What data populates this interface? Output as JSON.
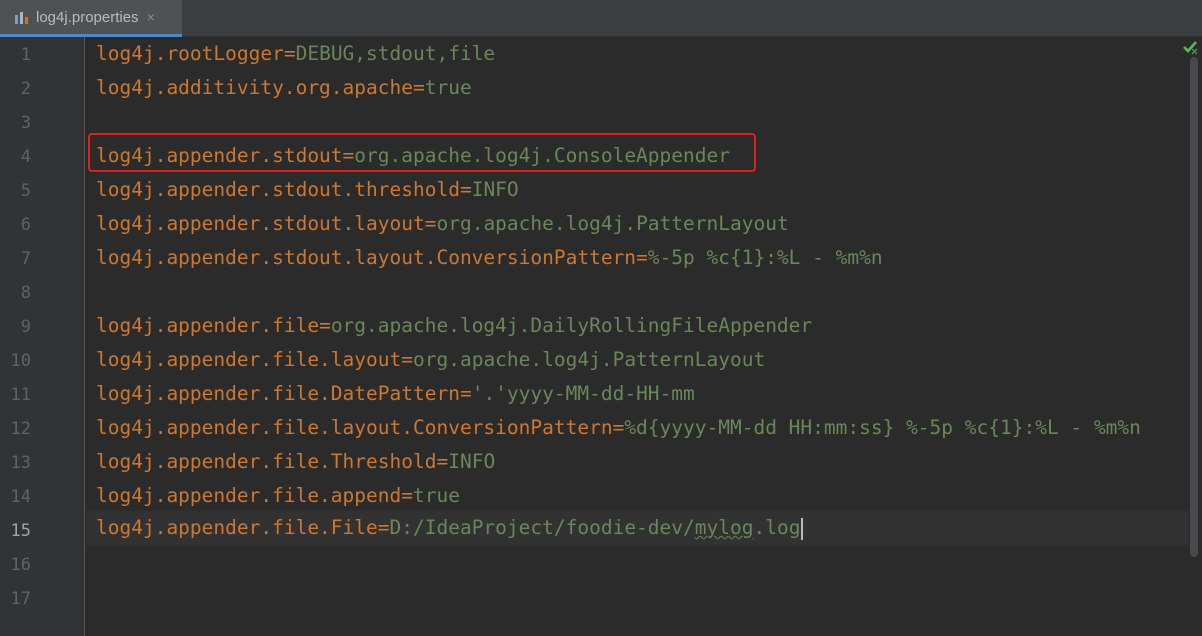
{
  "tab": {
    "title": "log4j.properties",
    "close_glyph": "×"
  },
  "status": {
    "check_icon": "inspection-ok"
  },
  "current_line": 15,
  "lines": [
    {
      "num": "1",
      "key": "log4j.rootLogger",
      "value": "DEBUG,stdout,file"
    },
    {
      "num": "2",
      "key": "log4j.additivity.org.apache",
      "value": "true"
    },
    {
      "num": "3",
      "key": "",
      "value": ""
    },
    {
      "num": "4",
      "key": "log4j.appender.stdout",
      "value": "org.apache.log4j.ConsoleAppender"
    },
    {
      "num": "5",
      "key": "log4j.appender.stdout.threshold",
      "value": "INFO"
    },
    {
      "num": "6",
      "key": "log4j.appender.stdout.layout",
      "value": "org.apache.log4j.PatternLayout"
    },
    {
      "num": "7",
      "key": "log4j.appender.stdout.layout.ConversionPattern",
      "value": "%-5p %c{1}:%L - %m%n"
    },
    {
      "num": "8",
      "key": "",
      "value": ""
    },
    {
      "num": "9",
      "key": "log4j.appender.file",
      "value": "org.apache.log4j.DailyRollingFileAppender"
    },
    {
      "num": "10",
      "key": "log4j.appender.file.layout",
      "value": "org.apache.log4j.PatternLayout"
    },
    {
      "num": "11",
      "key": "log4j.appender.file.DatePattern",
      "value": "'.'yyyy-MM-dd-HH-mm"
    },
    {
      "num": "12",
      "key": "log4j.appender.file.layout.ConversionPattern",
      "value": "%d{yyyy-MM-dd HH:mm:ss} %-5p %c{1}:%L - %m%n"
    },
    {
      "num": "13",
      "key": "log4j.appender.file.Threshold",
      "value": "INFO"
    },
    {
      "num": "14",
      "key": "log4j.appender.file.append",
      "value": "true"
    },
    {
      "num": "15",
      "key": "log4j.appender.file.File",
      "value_before": "D:/IdeaProject/foodie-dev/",
      "value_squiggle": "mylog",
      "value_after": ".log"
    },
    {
      "num": "16",
      "key": "",
      "value": ""
    },
    {
      "num": "17",
      "key": "",
      "value": ""
    }
  ],
  "equals": "="
}
